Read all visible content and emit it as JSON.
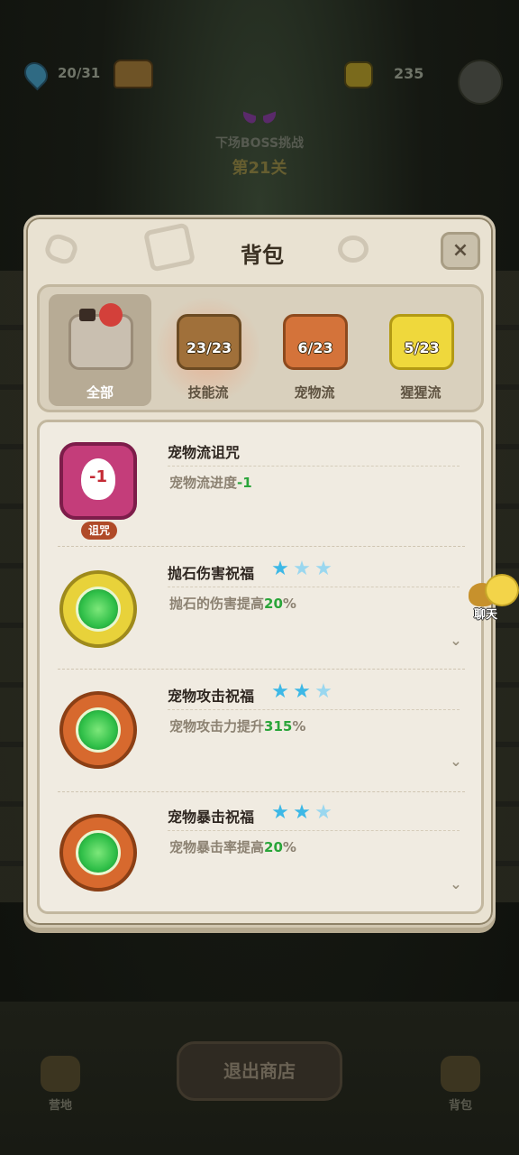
{
  "hud": {
    "location_progress": "20/31",
    "coins": "235",
    "boss_title": "下场BOSS挑战",
    "boss_stage": "第21关"
  },
  "modal": {
    "title": "背包",
    "close_glyph": "×",
    "tabs": [
      {
        "label": "全部",
        "count": "",
        "active": true
      },
      {
        "label": "技能流",
        "count": "23/23",
        "active": false
      },
      {
        "label": "宠物流",
        "count": "6/23",
        "active": false
      },
      {
        "label": "猩猩流",
        "count": "5/23",
        "active": false
      }
    ],
    "items": [
      {
        "name": "宠物流诅咒",
        "desc_prefix": "宠物流进度",
        "desc_value": "-1",
        "desc_suffix": "",
        "tag": "诅咒",
        "icon_value": "-1",
        "stars_filled": 0
      },
      {
        "name": "抛石伤害祝福",
        "desc_prefix": "抛石的伤害提高",
        "desc_value": "20",
        "desc_suffix": "%",
        "stars_filled": 1
      },
      {
        "name": "宠物攻击祝福",
        "desc_prefix": "宠物攻击力提升",
        "desc_value": "315",
        "desc_suffix": "%",
        "stars_filled": 2
      },
      {
        "name": "宠物暴击祝福",
        "desc_prefix": "宠物暴击率提高",
        "desc_value": "20",
        "desc_suffix": "%",
        "stars_filled": 2
      }
    ]
  },
  "chat": {
    "label": "聊天"
  },
  "bottom_nav": {
    "camp_label": "营地",
    "exit_label": "退出商店",
    "bag_label": "背包"
  },
  "icons": {
    "star": "★",
    "expand": "⌄",
    "colors": {
      "star_filled": "#3db8e6",
      "star_empty": "#9ad7ef",
      "highlight": "#2aa53a"
    }
  }
}
